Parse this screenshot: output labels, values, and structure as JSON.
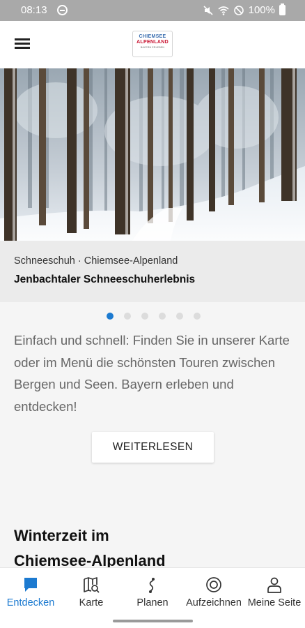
{
  "status_bar": {
    "time": "08:13",
    "battery": "100%",
    "icons": [
      "do-not-disturb-icon",
      "mute-icon",
      "wifi-icon",
      "blocked-icon",
      "battery-icon"
    ]
  },
  "app_bar": {
    "icons": [
      "menu-icon"
    ],
    "logo": {
      "line1": "CHIEMSEE",
      "line2": "ALPENLAND",
      "subline": "BAYERN ERLEBEN"
    }
  },
  "hero": {
    "category": "Schneeschuh · Chiemsee-Alpenland",
    "title": "Jenbachtaler Schneeschuherlebnis",
    "slides_total": 6,
    "active_slide": 1
  },
  "intro_text": "Einfach und schnell: Finden Sie in unserer Karte oder im Menü die schönsten Touren zwischen Bergen und Seen. Bayern erleben und entdecken!",
  "read_more_label": "WEITERLESEN",
  "section": {
    "title_line1": "Winterzeit im",
    "title_line2": "Chiemsee-Alpenland"
  },
  "bottom_nav": {
    "items": [
      {
        "label": "Entdecken",
        "icon": "chat-bubble-icon",
        "active": true
      },
      {
        "label": "Karte",
        "icon": "map-search-icon",
        "active": false
      },
      {
        "label": "Planen",
        "icon": "route-icon",
        "active": false
      },
      {
        "label": "Aufzeichnen",
        "icon": "record-icon",
        "active": false
      },
      {
        "label": "Meine Seite",
        "icon": "person-icon",
        "active": false
      }
    ]
  },
  "colors": {
    "accent": "#1c7ad0",
    "status_bar": "#a9a9a9",
    "caption_bg": "#ebebeb",
    "page_bg": "#f5f5f5"
  }
}
